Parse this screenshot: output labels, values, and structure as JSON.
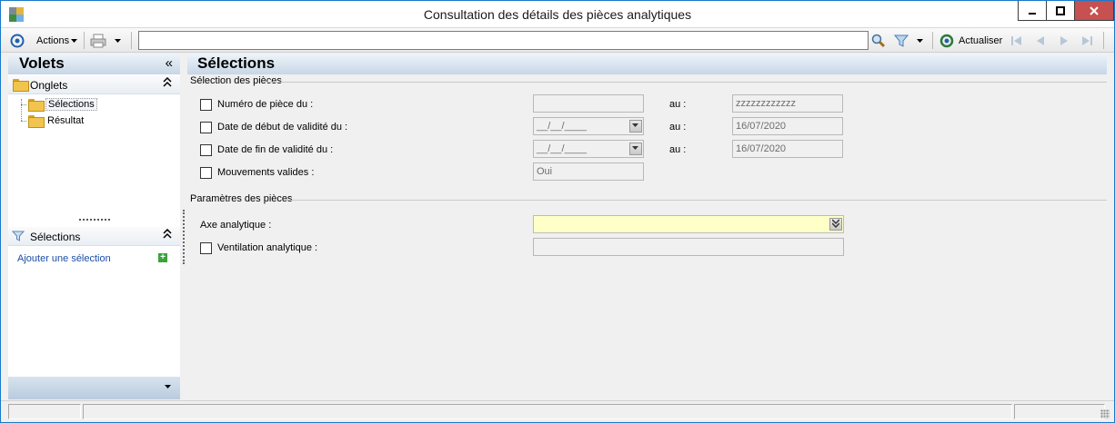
{
  "window": {
    "title": "Consultation des détails des pièces analytiques"
  },
  "toolbar": {
    "actions_label": "Actions",
    "refresh_label": "Actualiser",
    "search_value": ""
  },
  "left_pane": {
    "title": "Volets",
    "collapse": "«",
    "tabs_section": {
      "label": "Onglets",
      "items": [
        "Sélections",
        "Résultat"
      ]
    },
    "selections_section": {
      "label": "Sélections",
      "add_link": "Ajouter une sélection"
    }
  },
  "main": {
    "title": "Sélections",
    "group1_title": "Sélection des pièces",
    "group2_title": "Paramètres des pièces",
    "rows": {
      "numero": {
        "label": "Numéro de pièce du :",
        "from": "",
        "to_label": "au :",
        "to": "zzzzzzzzzzzz"
      },
      "date_debut": {
        "label": "Date de début de validité du :",
        "from": "__/__/____",
        "to_label": "au :",
        "to": "16/07/2020"
      },
      "date_fin": {
        "label": "Date de fin de validité du :",
        "from": "__/__/____",
        "to_label": "au :",
        "to": "16/07/2020"
      },
      "mouvements": {
        "label": "Mouvements valides :",
        "value": "Oui"
      },
      "axe": {
        "label": "Axe analytique :",
        "value": ""
      },
      "ventilation": {
        "label": "Ventilation analytique :",
        "value": ""
      }
    }
  },
  "colors": {
    "window_border": "#1979ca",
    "header_gradient": "#c7d6e6",
    "highlight_field": "#ffffc8",
    "link": "#1a4ea8"
  }
}
